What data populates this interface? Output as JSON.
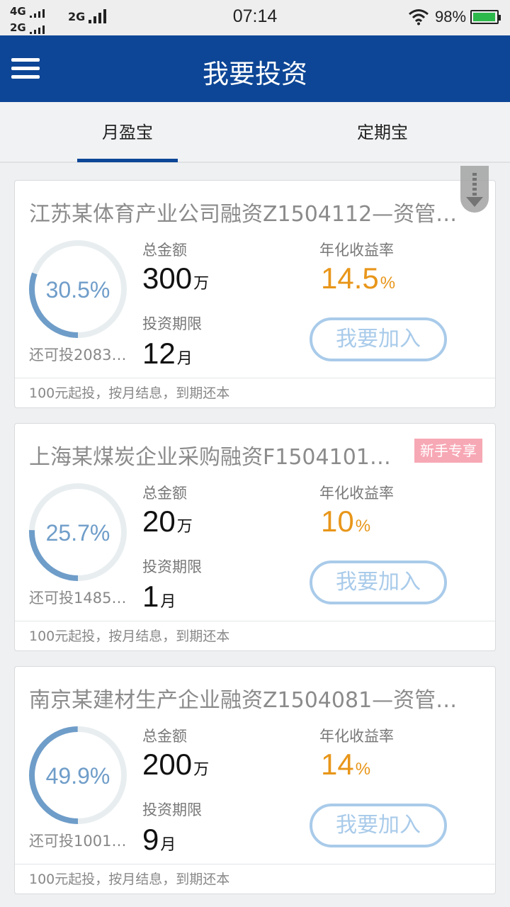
{
  "status_bar": {
    "network1": "4G",
    "network2": "2G",
    "network3": "2G",
    "time": "07:14",
    "battery_percent": "98%",
    "battery_level": 0.98,
    "battery_color": "#2db84b"
  },
  "header": {
    "title": "我要投资",
    "menu_icon": "hamburger-menu-icon",
    "bg_color": "#0d4696"
  },
  "tabs": [
    {
      "label": "月盈宝",
      "active": true
    },
    {
      "label": "定期宝",
      "active": false
    }
  ],
  "labels": {
    "total": "总金额",
    "term": "投资期限",
    "rate": "年化收益率",
    "join": "我要加入"
  },
  "products": [
    {
      "title": "江苏某体育产业公司融资Z1504112—资管…",
      "badge": "",
      "progress_text": "30.5%",
      "progress": 0.305,
      "remaining": "还可投2083…",
      "total_value": "300",
      "total_unit": "万",
      "term_value": "12",
      "term_unit": "月",
      "rate_value": "14.5",
      "rate_unit": "%",
      "footer": "100元起投，按月结息，到期还本"
    },
    {
      "title": "上海某煤炭企业采购融资F1504101…",
      "badge": "新手专享",
      "progress_text": "25.7%",
      "progress": 0.257,
      "remaining": "还可投1485…",
      "total_value": "20",
      "total_unit": "万",
      "term_value": "1",
      "term_unit": "月",
      "rate_value": "10",
      "rate_unit": "%",
      "footer": "100元起投，按月结息，到期还本"
    },
    {
      "title": "南京某建材生产企业融资Z1504081—资管…",
      "badge": "",
      "progress_text": "49.9%",
      "progress": 0.499,
      "remaining": "还可投1001…",
      "total_value": "200",
      "total_unit": "万",
      "term_value": "9",
      "term_unit": "月",
      "rate_value": "14",
      "rate_unit": "%",
      "footer": "100元起投，按月结息，到期还本"
    }
  ],
  "colors": {
    "accent": "#0d4696",
    "rate": "#e8961a",
    "ring": "#6f9dc9",
    "ring_track": "#e8eef0",
    "button": "#a9cbea",
    "badge": "#f7a8b5"
  },
  "scroll_icon": "scroll-down-arrow-icon"
}
